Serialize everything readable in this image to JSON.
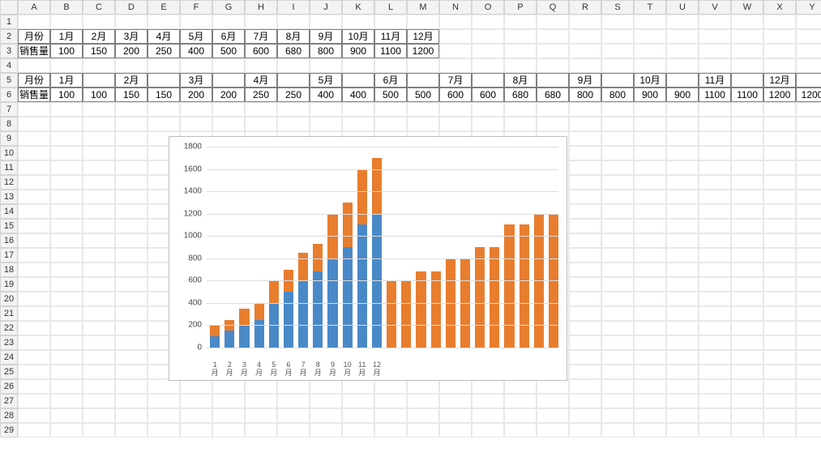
{
  "columns": [
    "A",
    "B",
    "C",
    "D",
    "E",
    "F",
    "G",
    "H",
    "I",
    "J",
    "K",
    "L",
    "M",
    "N",
    "O",
    "P",
    "Q",
    "R",
    "S",
    "T",
    "U",
    "V",
    "W",
    "X",
    "Y"
  ],
  "row_count": 29,
  "table1": {
    "r2": [
      "月份",
      "1月",
      "2月",
      "3月",
      "4月",
      "5月",
      "6月",
      "7月",
      "8月",
      "9月",
      "10月",
      "11月",
      "12月"
    ],
    "r3": [
      "销售量",
      "100",
      "150",
      "200",
      "250",
      "400",
      "500",
      "600",
      "680",
      "800",
      "900",
      "1100",
      "1200"
    ]
  },
  "table2": {
    "r5": [
      "月份",
      "1月",
      "",
      "2月",
      "",
      "3月",
      "",
      "4月",
      "",
      "5月",
      "",
      "6月",
      "",
      "7月",
      "",
      "8月",
      "",
      "9月",
      "",
      "10月",
      "",
      "11月",
      "",
      "12月",
      ""
    ],
    "r6": [
      "销售量",
      "100",
      "100",
      "150",
      "150",
      "200",
      "200",
      "250",
      "250",
      "400",
      "400",
      "500",
      "500",
      "600",
      "600",
      "680",
      "680",
      "800",
      "800",
      "900",
      "900",
      "1100",
      "1100",
      "1200",
      "1200"
    ]
  },
  "chart_data": {
    "type": "bar",
    "stacked": true,
    "ylim": [
      0,
      1800
    ],
    "yticks": [
      0,
      200,
      400,
      600,
      800,
      1000,
      1200,
      1400,
      1600,
      1800
    ],
    "categories": [
      "1月",
      "2月",
      "3月",
      "4月",
      "5月",
      "6月",
      "7月",
      "8月",
      "9月",
      "10月",
      "11月",
      "12月",
      "",
      "",
      "",
      "",
      "",
      "",
      "",
      "",
      "",
      "",
      "",
      ""
    ],
    "series": [
      {
        "name": "blue",
        "color": "#4a89c8",
        "values": [
          100,
          150,
          200,
          250,
          400,
          500,
          600,
          680,
          800,
          900,
          1100,
          1200,
          0,
          0,
          0,
          0,
          0,
          0,
          0,
          0,
          0,
          0,
          0,
          0
        ]
      },
      {
        "name": "orange",
        "color": "#e87d2e",
        "values": [
          100,
          100,
          150,
          150,
          200,
          200,
          250,
          250,
          400,
          400,
          500,
          500,
          600,
          600,
          680,
          680,
          800,
          800,
          900,
          900,
          1100,
          1100,
          1200,
          1200
        ]
      }
    ],
    "stack_totals": [
      200,
      250,
      350,
      400,
      600,
      700,
      850,
      930,
      1200,
      1300,
      1600,
      1700,
      600,
      600,
      680,
      680,
      800,
      800,
      900,
      900,
      1100,
      1100,
      1200,
      1200
    ]
  }
}
